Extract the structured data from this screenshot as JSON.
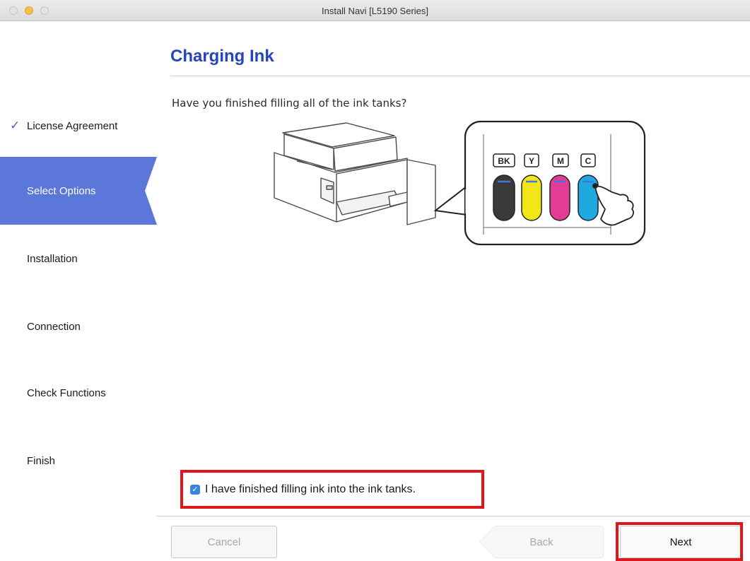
{
  "window": {
    "title": "Install Navi [L5190 Series]"
  },
  "sidebar": {
    "items": [
      {
        "label": "License Agreement",
        "state": "done"
      },
      {
        "label": "Select Options",
        "state": "active"
      },
      {
        "label": "Installation",
        "state": "pending"
      },
      {
        "label": "Connection",
        "state": "pending"
      },
      {
        "label": "Check Functions",
        "state": "pending"
      },
      {
        "label": "Finish",
        "state": "pending"
      }
    ],
    "check_glyph": "✓"
  },
  "main": {
    "title": "Charging Ink",
    "question": "Have you finished filling all of the ink tanks?",
    "ink_tanks": [
      {
        "label": "BK",
        "color": "#3a3a3a"
      },
      {
        "label": "Y",
        "color": "#f3e617"
      },
      {
        "label": "M",
        "color": "#e23c96"
      },
      {
        "label": "C",
        "color": "#20a8e0"
      }
    ],
    "confirm_checkbox": {
      "label": "I have finished filling ink into the ink tanks.",
      "checked": true,
      "mark": "✓"
    }
  },
  "footer": {
    "cancel_label": "Cancel",
    "back_label": "Back",
    "next_label": "Next"
  },
  "colors": {
    "accent": "#2546b8",
    "sidebar_active": "#5b77d9",
    "highlight": "#e0161b"
  }
}
